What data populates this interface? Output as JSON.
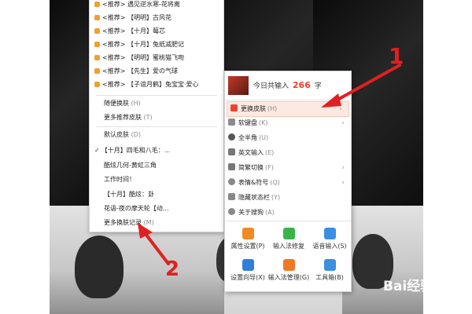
{
  "theme_menu": {
    "recommended": [
      "<推荐> 遇见逆水寒-花将离",
      "<推荐> 【明明】古风花",
      "<推荐> 【十月】莓芯",
      "<推荐> 【十月】兔纸减肥记",
      "<推荐> 【明明】蜜桃猫飞吻",
      "<推荐> 【先生】爱の气球",
      "<推荐> 【子谊月鹤】兔宝宝·爱心"
    ],
    "random_skin": "随便换肤",
    "random_skin_shortcut": "(H)",
    "more_recommended": "更多推荐皮肤",
    "more_recommended_shortcut": "(T)",
    "default_skin": "默认皮肤",
    "default_skin_shortcut": "(D)",
    "history": [
      "【十月】四毛和八毛：...",
      "酷炫几何-黄虹三角",
      "工作时间！",
      "【十月】酷炫：卦",
      "花语-夜の摩天轮【动..."
    ],
    "more_history": "更多换肤记录",
    "more_history_shortcut": "(M)"
  },
  "ime_menu": {
    "header_prefix": "今日共输入",
    "header_count": "266",
    "header_suffix": "字",
    "items": [
      {
        "label": "更换皮肤",
        "shortcut": "(H)"
      },
      {
        "label": "软键盘",
        "shortcut": "(K)"
      },
      {
        "label": "全半角",
        "shortcut": "(U)"
      },
      {
        "label": "英文输入",
        "shortcut": "(E)"
      },
      {
        "label": "简繁切换",
        "shortcut": "(F)"
      },
      {
        "label": "表情&符号",
        "shortcut": "(Q)"
      },
      {
        "label": "隐藏状态栏",
        "shortcut": "(Y)"
      },
      {
        "label": "关于搜狗",
        "shortcut": "(A)"
      }
    ],
    "tools": [
      {
        "label": "属性设置",
        "shortcut": "(P)",
        "icon": "gear-icon"
      },
      {
        "label": "输入法修复",
        "shortcut": "",
        "icon": "toolbox-icon"
      },
      {
        "label": "语音输入",
        "shortcut": "(S)",
        "icon": "microphone-icon"
      },
      {
        "label": "设置向导",
        "shortcut": "(X)",
        "icon": "flag-icon"
      },
      {
        "label": "输入法管理",
        "shortcut": "(G)",
        "icon": "manager-icon"
      },
      {
        "label": "工具箱",
        "shortcut": "(B)",
        "icon": "grid-icon"
      }
    ]
  },
  "annotations": {
    "arrow1_label": "1",
    "arrow2_label": "2"
  },
  "watermark": "Bai经验",
  "colors": {
    "accent": "#e8432e",
    "annotation": "#e02020",
    "count": "#e8432e",
    "hover": "#fde9e1"
  }
}
